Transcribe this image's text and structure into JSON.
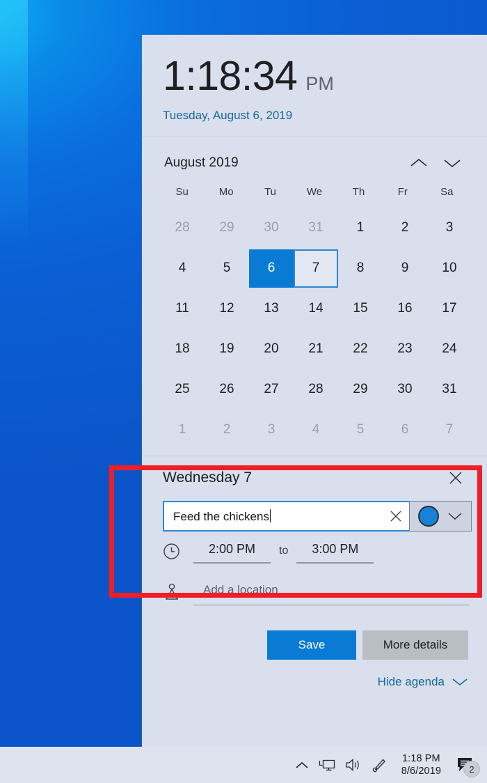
{
  "desktop": {
    "wallpaper_color": "#0a64d8"
  },
  "flyout": {
    "clock": {
      "time": "1:18:34",
      "ampm": "PM",
      "date": "Tuesday, August 6, 2019"
    },
    "calendar": {
      "month_label": "August 2019",
      "prev_icon": "chevron-up-icon",
      "next_icon": "chevron-down-icon",
      "weekdays": [
        "Su",
        "Mo",
        "Tu",
        "We",
        "Th",
        "Fr",
        "Sa"
      ],
      "today": 6,
      "selected": 7,
      "weeks": [
        [
          {
            "d": "28",
            "state": "muted"
          },
          {
            "d": "29",
            "state": "muted"
          },
          {
            "d": "30",
            "state": "muted"
          },
          {
            "d": "31",
            "state": "muted"
          },
          {
            "d": "1",
            "state": "normal"
          },
          {
            "d": "2",
            "state": "normal"
          },
          {
            "d": "3",
            "state": "normal"
          }
        ],
        [
          {
            "d": "4",
            "state": "normal"
          },
          {
            "d": "5",
            "state": "normal"
          },
          {
            "d": "6",
            "state": "today"
          },
          {
            "d": "7",
            "state": "selected"
          },
          {
            "d": "8",
            "state": "normal"
          },
          {
            "d": "9",
            "state": "normal"
          },
          {
            "d": "10",
            "state": "normal"
          }
        ],
        [
          {
            "d": "11",
            "state": "normal"
          },
          {
            "d": "12",
            "state": "normal"
          },
          {
            "d": "13",
            "state": "normal"
          },
          {
            "d": "14",
            "state": "normal"
          },
          {
            "d": "15",
            "state": "normal"
          },
          {
            "d": "16",
            "state": "normal"
          },
          {
            "d": "17",
            "state": "normal"
          }
        ],
        [
          {
            "d": "18",
            "state": "normal"
          },
          {
            "d": "19",
            "state": "normal"
          },
          {
            "d": "20",
            "state": "normal"
          },
          {
            "d": "21",
            "state": "normal"
          },
          {
            "d": "22",
            "state": "normal"
          },
          {
            "d": "23",
            "state": "normal"
          },
          {
            "d": "24",
            "state": "normal"
          }
        ],
        [
          {
            "d": "25",
            "state": "normal"
          },
          {
            "d": "26",
            "state": "normal"
          },
          {
            "d": "27",
            "state": "normal"
          },
          {
            "d": "28",
            "state": "normal"
          },
          {
            "d": "29",
            "state": "normal"
          },
          {
            "d": "30",
            "state": "normal"
          },
          {
            "d": "31",
            "state": "normal"
          }
        ],
        [
          {
            "d": "1",
            "state": "muted"
          },
          {
            "d": "2",
            "state": "muted"
          },
          {
            "d": "3",
            "state": "muted"
          },
          {
            "d": "4",
            "state": "muted"
          },
          {
            "d": "5",
            "state": "muted"
          },
          {
            "d": "6",
            "state": "muted"
          },
          {
            "d": "7",
            "state": "muted"
          }
        ]
      ]
    },
    "agenda": {
      "day_label": "Wednesday 7",
      "close_icon": "close-icon",
      "event": {
        "title_value": "Feed the chickens",
        "title_placeholder": "Add an event or reminder",
        "clear_icon": "close-icon",
        "calendar_color": "#1683d8",
        "color_chevron_icon": "chevron-down-icon",
        "clock_icon": "clock-icon",
        "start_time": "2:00 PM",
        "to_label": "to",
        "end_time": "3:00 PM",
        "location_icon": "location-pin-icon",
        "location_placeholder": "Add a location",
        "location_value": ""
      },
      "save_label": "Save",
      "more_details_label": "More details",
      "hide_agenda_label": "Hide agenda",
      "hide_agenda_icon": "chevron-down-icon"
    }
  },
  "taskbar": {
    "show_hidden_icons_icon": "chevron-up-icon",
    "network_icon": "network-monitor-icon",
    "volume_icon": "speaker-icon",
    "pen_icon": "pen-workspace-icon",
    "clock_time": "1:18 PM",
    "clock_date": "8/6/2019",
    "action_center_icon": "action-center-icon",
    "action_center_badge": "2"
  },
  "annotation": {
    "color": "#f01e25",
    "shape": "rectangle"
  }
}
